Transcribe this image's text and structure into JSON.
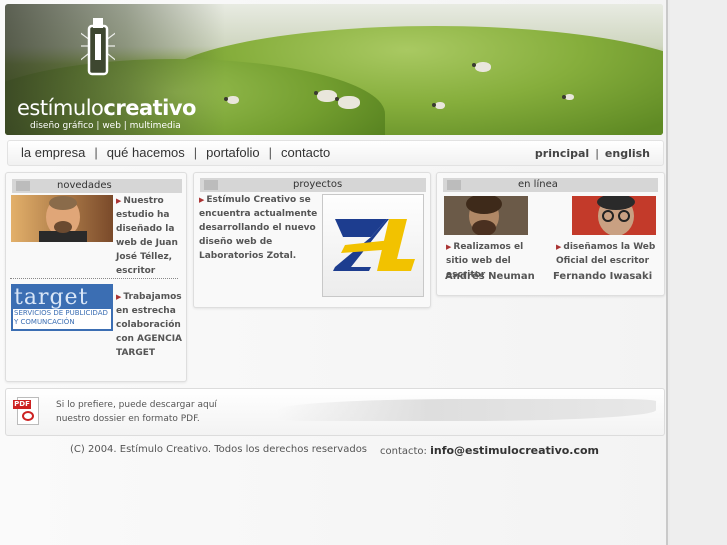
{
  "header": {
    "brand_light": "estímulo",
    "brand_bold": "creativo",
    "tagline": "diseño gráfico | web | multimedia"
  },
  "nav": {
    "items": [
      "la empresa",
      "qué hacemos",
      "portafolio",
      "contacto"
    ],
    "separator": "|",
    "lang_items": [
      "principal",
      "english"
    ]
  },
  "novedades": {
    "title": "novedades",
    "item1_text": "Nuestro estudio ha diseñado la web de Juan José Téllez, escritor",
    "item2_text": "Trabajamos en estrecha colaboración con AGENCIA TARGET",
    "target_logo": "target",
    "target_caption1": "SERVICIOS DE PUBLICIDAD",
    "target_caption2": "Y COMUNCACIÓN"
  },
  "proyectos": {
    "title": "proyectos",
    "text": "Estímulo Creativo se encuentra actualmente desarrollando el nuevo diseño web de Laboratorios Zotal."
  },
  "en_linea": {
    "title": "en línea",
    "person1_text": "Realizamos el sitio web del escritor",
    "person1_name": "Andrés Neuman",
    "person2_text": "diseñamos la Web Oficial del escritor",
    "person2_name": "Fernando Iwasaki"
  },
  "pdf": {
    "icon_label": "PDF",
    "line1": "Si lo prefiere, puede descargar aquí",
    "line2": "nuestro dossier en formato PDF."
  },
  "footer": {
    "copyright": "(C) 2004. Estímulo Creativo. Todos los derechos reservados",
    "contact_label": "contacto:",
    "contact_email": "info@estimulocreativo.com"
  },
  "colors": {
    "accent_arrow": "#aa3333",
    "zotal_blue": "#1d3d8f",
    "zotal_yellow": "#f2c200",
    "target_blue": "#3b6eb3"
  }
}
